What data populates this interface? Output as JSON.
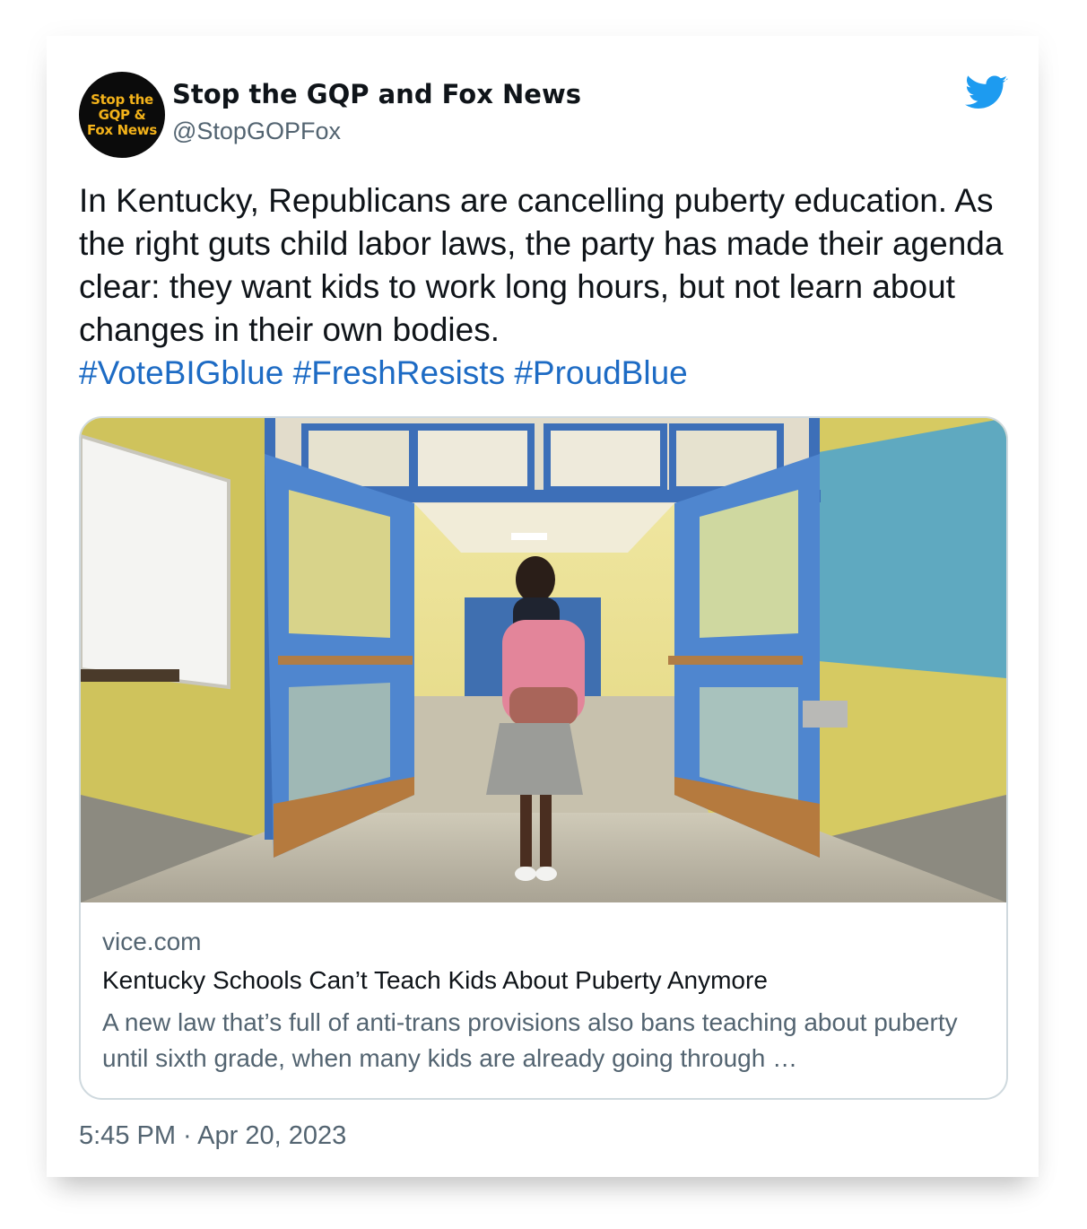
{
  "tweet": {
    "avatar": {
      "line1": "Stop the",
      "line2": "GQP &",
      "line3": "Fox News"
    },
    "display_name": "Stop the GQP and Fox News",
    "handle": "@StopGOPFox",
    "text": "In Kentucky, Republicans are cancelling puberty education. As the right guts child labor laws, the party has made their agenda clear: they want kids to work long hours, but not learn about changes in their own bodies.",
    "hashtags": [
      "#VoteBIGblue",
      "#FreshResists",
      "#ProudBlue"
    ],
    "timestamp": "5:45 PM · Apr 20, 2023"
  },
  "link_card": {
    "domain": "vice.com",
    "title": "Kentucky Schools Can’t Teach Kids About Puberty Anymore",
    "description": "A new law that’s full of anti-trans provisions also bans teaching about puberty until sixth grade, when many kids are already going through …"
  },
  "icons": {
    "brand": "twitter-bird-icon"
  },
  "colors": {
    "link": "#1d6bc4",
    "text": "#0f1419",
    "muted": "#536471",
    "brand": "#1d9bf0"
  }
}
